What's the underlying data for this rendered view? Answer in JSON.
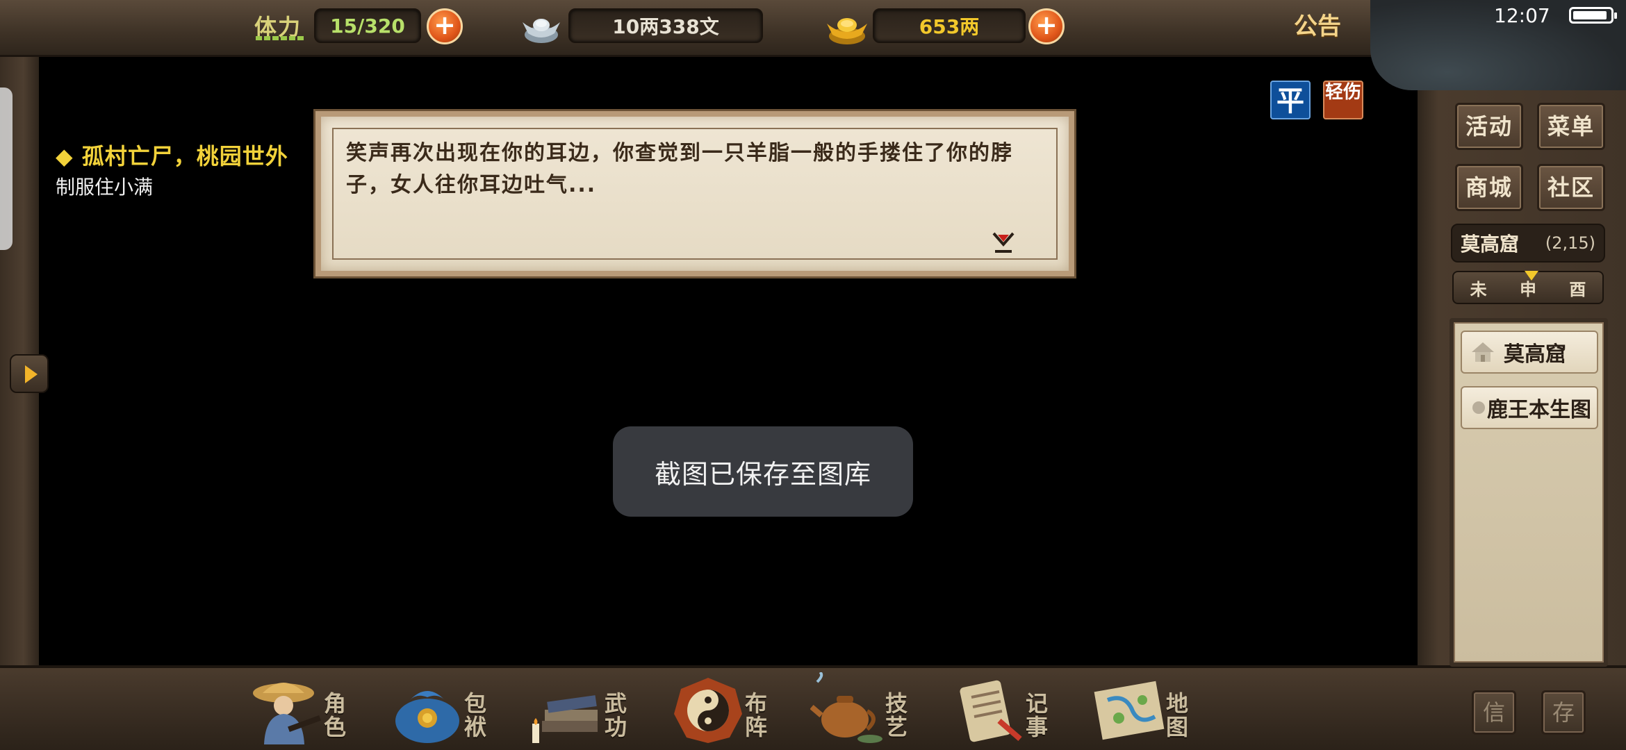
{
  "topbar": {
    "stamina_label": "体力",
    "stamina_value": "15/320",
    "silver_value": "10两338文",
    "gold_value": "653两",
    "plus": "+",
    "notice": "公告"
  },
  "status_bar": {
    "time": "12:07"
  },
  "quest": {
    "title": "◆ 孤村亡尸，桃园世外",
    "subtitle": "制服住小满"
  },
  "dialog": {
    "text": "笑声再次出现在你的耳边，你查觉到一只羊脂一般的手搂住了你的脖子，女人往你耳边吐气..."
  },
  "badges": {
    "calm": "平",
    "hurt": "轻伤"
  },
  "right_menu": {
    "activity": "活动",
    "menu": "菜单",
    "shop": "商城",
    "community": "社区"
  },
  "location": {
    "name": "莫高窟",
    "coords": "(2,15)"
  },
  "time_of_day": [
    "未",
    "申",
    "酉"
  ],
  "scene_list": [
    {
      "label": "莫高窟",
      "icon": "house-icon"
    },
    {
      "label": "鹿王本生图",
      "icon": "painting-icon"
    }
  ],
  "toast": "截图已保存至图库",
  "bottom_nav": [
    {
      "label": "角色",
      "icon": "character-icon"
    },
    {
      "label": "包袱",
      "icon": "bundle-icon"
    },
    {
      "label": "武功",
      "icon": "martial-arts-icon"
    },
    {
      "label": "布阵",
      "icon": "formation-icon"
    },
    {
      "label": "技艺",
      "icon": "teapot-icon"
    },
    {
      "label": "记事",
      "icon": "journal-icon"
    },
    {
      "label": "地图",
      "icon": "map-icon"
    }
  ],
  "corner_buttons": {
    "mail": "信",
    "save": "存"
  },
  "colors": {
    "gold": "#f2c82b",
    "stamina": "#b8e06a",
    "wood": "#4a3b2d",
    "calm": "#0e4f9a",
    "hurt": "#a33a14"
  }
}
